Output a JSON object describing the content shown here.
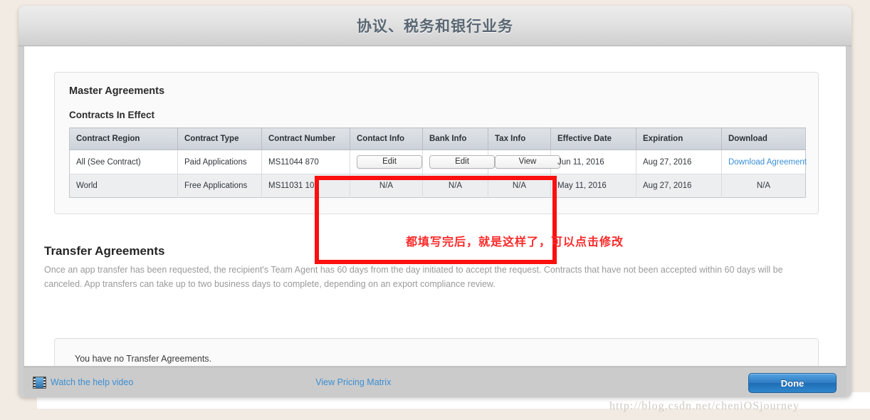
{
  "window": {
    "title": "协议、税务和银行业务"
  },
  "master": {
    "section_title": "Master Agreements",
    "sub_title": "Contracts In Effect",
    "columns": [
      "Contract Region",
      "Contract Type",
      "Contract Number",
      "Contact Info",
      "Bank Info",
      "Tax Info",
      "Effective Date",
      "Expiration",
      "Download"
    ],
    "rows": [
      {
        "region": "All (See Contract)",
        "type": "Paid Applications",
        "number": "MS11044 870",
        "contact_info": "Edit",
        "bank_info": "Edit",
        "tax_info": "View",
        "effective_date": "Jun 11, 2016",
        "expiration": "Aug 27, 2016",
        "download": "Download Agreement"
      },
      {
        "region": "World",
        "type": "Free Applications",
        "number": "MS11031 103",
        "contact_info": "N/A",
        "bank_info": "N/A",
        "tax_info": "N/A",
        "effective_date": "May 11, 2016",
        "expiration": "Aug 27, 2016",
        "download": "N/A"
      }
    ]
  },
  "transfer": {
    "title": "Transfer Agreements",
    "description": "Once an app transfer has been requested, the recipient's Team Agent has 60 days from the day initiated to accept the request. Contracts that have not been accepted within 60 days will be canceled. App transfers can take up to two business days to complete, depending on an export compliance review.",
    "empty_message": "You have no Transfer Agreements."
  },
  "footer": {
    "help_video_label": "Watch the help video",
    "pricing_label": "View Pricing Matrix",
    "done_label": "Done",
    "video_icon": "video-film-icon"
  },
  "annotation": {
    "text": "都填写完后，就是这样了，可以点击修改",
    "box_color": "#fb0f0f",
    "text_color": "#fb2a2a"
  },
  "watermark": {
    "text": "http://blog.csdn.net/cheniOSjourney"
  },
  "colors": {
    "page_background": "#f2ebe3",
    "link": "#3a8fd4",
    "title": "#5a6773",
    "done_button": "#2d7dc4"
  }
}
